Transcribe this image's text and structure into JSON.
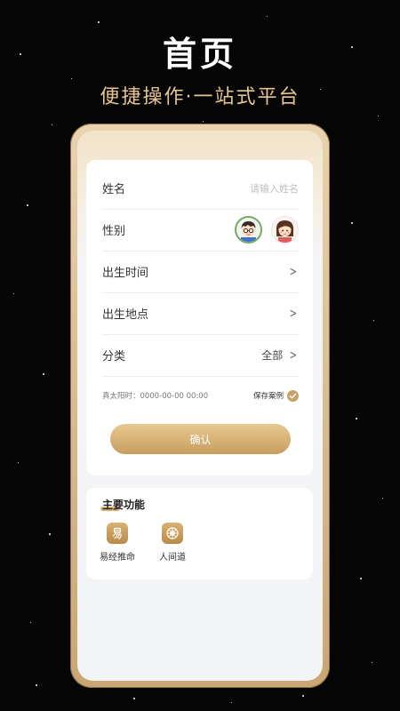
{
  "hero": {
    "title": "首页",
    "subtitle": "便捷操作·一站式平台"
  },
  "form": {
    "name_label": "姓名",
    "name_placeholder": "请输入姓名",
    "gender_label": "性别",
    "birth_time_label": "出生时间",
    "birth_place_label": "出生地点",
    "category_label": "分类",
    "category_value": "全部",
    "solar_time": "真太阳时：0000-00-00 00:00",
    "save_case_label": "保存案例",
    "save_case_checked": true,
    "confirm_label": "确认"
  },
  "functions": {
    "title": "主要功能",
    "items": [
      {
        "label": "易经推命",
        "icon": "yi-icon"
      },
      {
        "label": "人间道",
        "icon": "wheel-icon"
      }
    ]
  },
  "colors": {
    "accent_gold": "#c89e5e",
    "subtitle_gold": "#e7c58e",
    "background": "#050505"
  }
}
